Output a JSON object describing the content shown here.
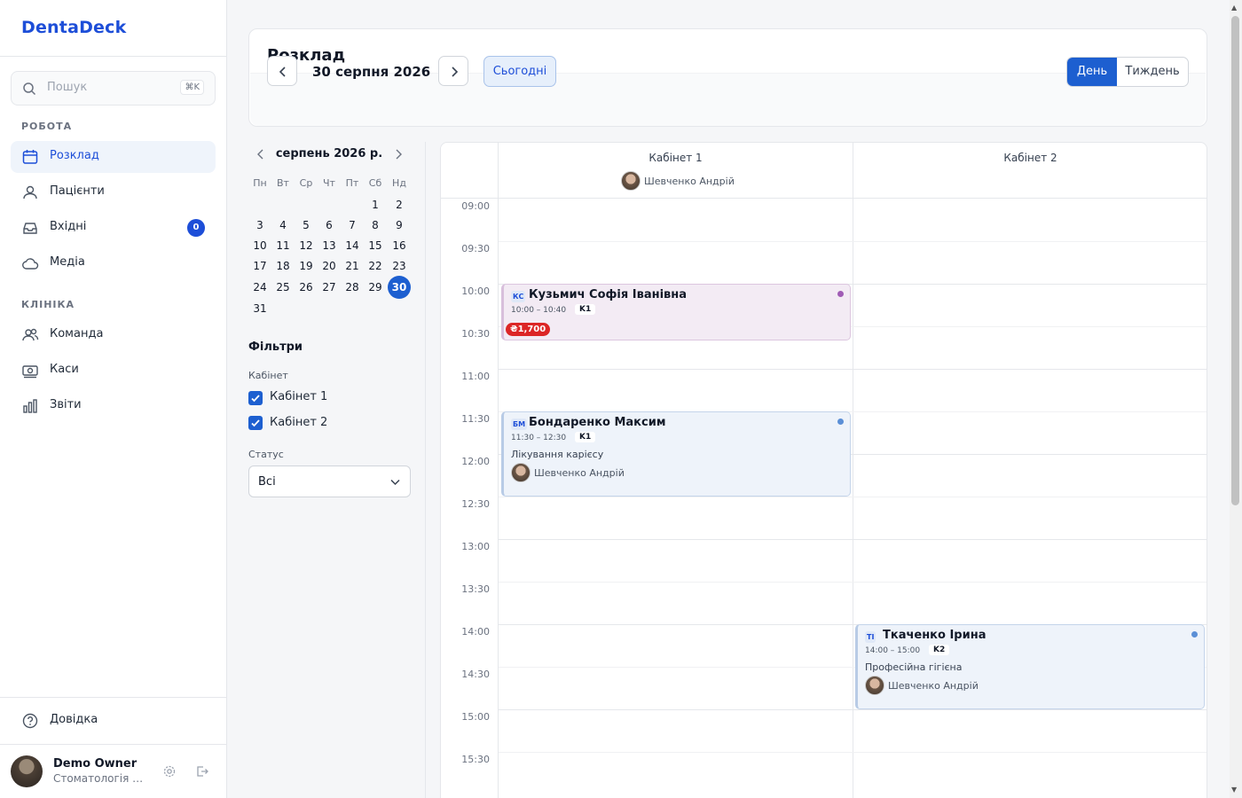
{
  "app": {
    "brand": "DentaDeck"
  },
  "search": {
    "placeholder": "Пошук",
    "shortcut": "⌘K"
  },
  "sidebar": {
    "section_work": "РОБОТА",
    "section_clinic": "КЛІНІКА",
    "items": [
      {
        "label": "Розклад",
        "icon": "calendar-icon"
      },
      {
        "label": "Пацієнти",
        "icon": "users-icon"
      },
      {
        "label": "Вхідні",
        "icon": "inbox-icon",
        "badge": "0"
      },
      {
        "label": "Медіа",
        "icon": "cloud-icon"
      },
      {
        "label": "Команда",
        "icon": "team-icon"
      },
      {
        "label": "Каси",
        "icon": "cash-icon"
      },
      {
        "label": "Звіти",
        "icon": "chart-icon"
      }
    ],
    "help": "Довідка",
    "user": {
      "name": "Demo Owner",
      "org": "Стоматологія Посмішка"
    }
  },
  "header": {
    "title": "Розклад",
    "date": "30 серпня 2026",
    "today": "Сьогодні",
    "view_day": "День",
    "view_week": "Тиждень",
    "active_view": "День"
  },
  "mini_calendar": {
    "title": "серпень 2026 р.",
    "weekdays": [
      "Пн",
      "Вт",
      "Ср",
      "Чт",
      "Пт",
      "Сб",
      "Нд"
    ],
    "days": [
      "1",
      "2",
      "3",
      "4",
      "5",
      "6",
      "7",
      "8",
      "9",
      "10",
      "11",
      "12",
      "13",
      "14",
      "15",
      "16",
      "17",
      "18",
      "19",
      "20",
      "21",
      "22",
      "23",
      "24",
      "25",
      "26",
      "27",
      "28",
      "29",
      "30",
      "31"
    ],
    "selected": "30"
  },
  "filters": {
    "title": "Фільтри",
    "cabinet_label": "Кабінет",
    "cabinets": [
      "Кабінет 1",
      "Кабінет 2"
    ],
    "status_label": "Статус",
    "status_value": "Всі"
  },
  "schedule": {
    "rooms": [
      {
        "name": "Кабінет 1",
        "doctor": "Шевченко Андрій"
      },
      {
        "name": "Кабінет 2",
        "doctor": ""
      }
    ],
    "times": [
      "09:00",
      "09:30",
      "10:00",
      "10:30",
      "11:00",
      "11:30",
      "12:00",
      "12:30",
      "13:00",
      "13:30",
      "14:00",
      "14:30",
      "15:00",
      "15:30"
    ],
    "appointments": [
      {
        "initials": "КС",
        "patient": "Кузьмич Софія Іванівна",
        "time": "10:00 – 10:40",
        "cabinet": "K1",
        "price": "₴1,700",
        "dot_color": "#a05cb5"
      },
      {
        "initials": "БМ",
        "patient": "Бондаренко Максим",
        "time": "11:30 – 12:30",
        "cabinet": "K1",
        "procedure": "Лікування карієсу",
        "doctor": "Шевченко Андрій",
        "dot_color": "#5b8fd6"
      },
      {
        "initials": "ТІ",
        "patient": "Ткаченко Ірина",
        "time": "14:00 – 15:00",
        "cabinet": "K2",
        "procedure": "Професійна гігієна",
        "doctor": "Шевченко Андрій",
        "dot_color": "#5b8fd6"
      }
    ]
  },
  "colors": {
    "accent": "#1d5fd0",
    "price_badge": "#dc2626"
  }
}
